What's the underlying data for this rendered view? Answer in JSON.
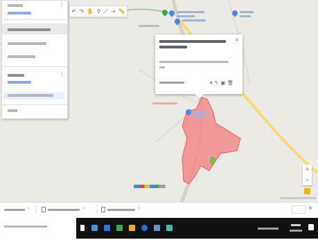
{
  "side_panel": {
    "top_label": "",
    "sub_label": "",
    "layer_actions": "",
    "layer_item_1": "",
    "layer_item_2": "",
    "layer2_title": "",
    "layer2_style": "",
    "selected_feature": "",
    "more_item": ""
  },
  "popup": {
    "title": "",
    "description": "",
    "extra_line": "",
    "coordinates": ""
  },
  "colors": {
    "polygon_fill": "#f28b8b",
    "polygon_stroke": "#e06363",
    "feature_marker": "#7cc242",
    "pin_blue": "#4285f4",
    "road": "#f7dc6f"
  },
  "download_bar": {
    "items": [
      {
        "label": ""
      },
      {
        "label": ""
      },
      {
        "label": ""
      }
    ],
    "show_all_label": ""
  },
  "taskbar": {
    "search_placeholder": "",
    "time": "",
    "date": ""
  }
}
